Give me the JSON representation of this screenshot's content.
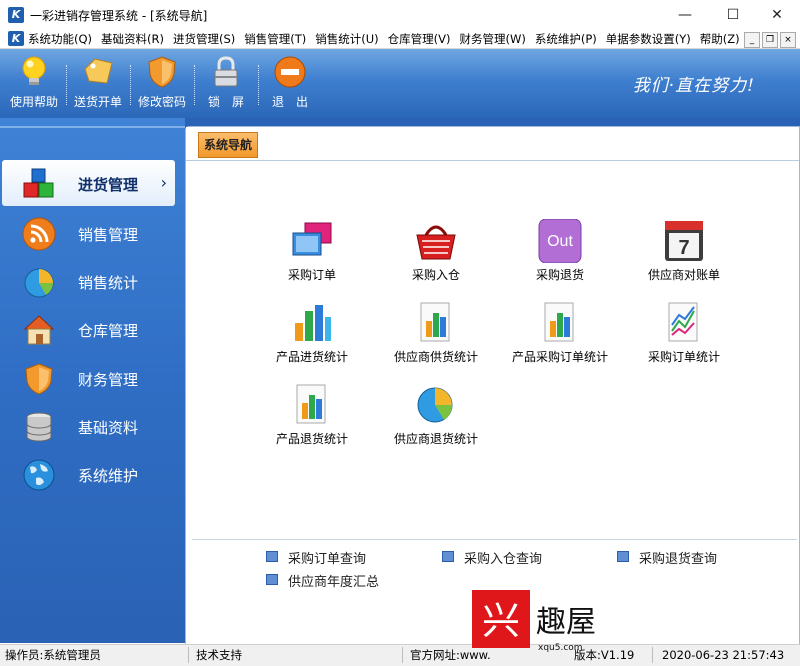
{
  "window": {
    "title": "一彩进销存管理系统 - [系统导航]",
    "app_icon": "K",
    "minimize": "—",
    "maximize": "☐",
    "close": "✕"
  },
  "menu": {
    "items": [
      "系统功能(Q)",
      "基础资料(R)",
      "进货管理(S)",
      "销售管理(T)",
      "销售统计(U)",
      "仓库管理(V)",
      "财务管理(W)",
      "系统维护(P)",
      "单据参数设置(Y)",
      "帮助(Z)"
    ],
    "mdi_minimize": "_",
    "mdi_restore": "❐",
    "mdi_close": "×"
  },
  "toolbar": {
    "buttons": [
      {
        "label": "使用帮助",
        "icon": "lightbulb-icon"
      },
      {
        "label": "送货开单",
        "icon": "tag-icon"
      },
      {
        "label": "修改密码",
        "icon": "shield-icon"
      },
      {
        "label": "锁　屏",
        "icon": "padlock-icon"
      },
      {
        "label": "退　出",
        "icon": "exit-icon"
      }
    ],
    "slogan": "我们·直在努力!"
  },
  "sidebar": {
    "items": [
      {
        "label": "进货管理",
        "icon": "blocks-icon",
        "active": true
      },
      {
        "label": "销售管理",
        "icon": "rss-icon"
      },
      {
        "label": "销售统计",
        "icon": "pie-chart-icon"
      },
      {
        "label": "仓库管理",
        "icon": "house-icon"
      },
      {
        "label": "财务管理",
        "icon": "shield-icon"
      },
      {
        "label": "基础资料",
        "icon": "database-icon"
      },
      {
        "label": "系统维护",
        "icon": "globe-icon"
      }
    ],
    "chevron": "›"
  },
  "main": {
    "tab": "系统导航",
    "functions": [
      {
        "label": "采购订单",
        "icon": "purchase-order-icon"
      },
      {
        "label": "采购入仓",
        "icon": "basket-icon"
      },
      {
        "label": "采购退货",
        "icon": "out-icon",
        "icon_text": "Out"
      },
      {
        "label": "供应商对账单",
        "icon": "calendar-icon",
        "icon_text": "7"
      },
      {
        "label": "产品进货统计",
        "icon": "bar-chart-icon"
      },
      {
        "label": "供应商供货统计",
        "icon": "report-chart-icon"
      },
      {
        "label": "产品采购订单统计",
        "icon": "report-chart-icon"
      },
      {
        "label": "采购订单统计",
        "icon": "line-chart-icon"
      },
      {
        "label": "产品退货统计",
        "icon": "report-chart-icon"
      },
      {
        "label": "供应商退货统计",
        "icon": "pie-chart-icon"
      }
    ],
    "quick_links": [
      "采购订单查询",
      "采购入仓查询",
      "采购退货查询",
      "供应商年度汇总"
    ]
  },
  "statusbar": {
    "operator": "操作员:系统管理员",
    "support": "技术支持",
    "website": "官方网址:www.",
    "version": "版本:V1.19",
    "datetime": "2020-06-23 21:57:43"
  },
  "watermark": {
    "logo_char": "兴",
    "text": "趣屋",
    "url": "xqu5.com"
  }
}
